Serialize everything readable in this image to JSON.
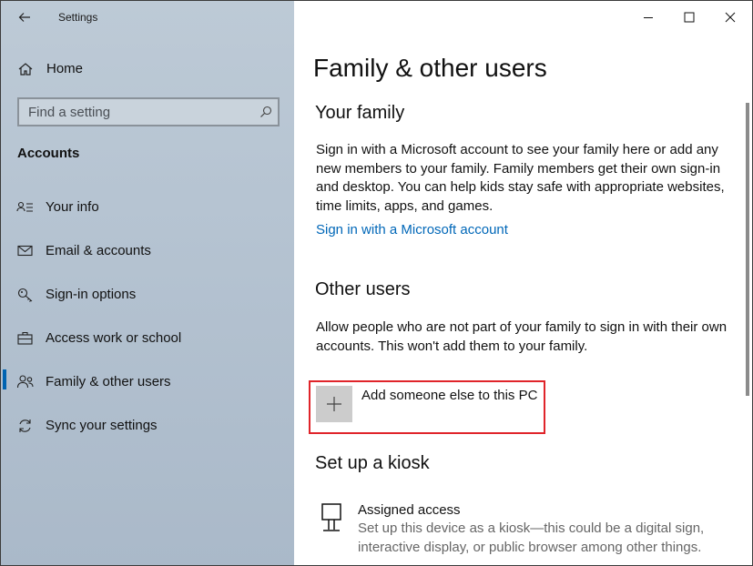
{
  "window": {
    "title": "Settings"
  },
  "sidebar": {
    "home_label": "Home",
    "search_placeholder": "Find a setting",
    "section_heading": "Accounts",
    "items": [
      {
        "label": "Your info",
        "icon": "person-card-icon"
      },
      {
        "label": "Email & accounts",
        "icon": "mail-icon"
      },
      {
        "label": "Sign-in options",
        "icon": "key-icon"
      },
      {
        "label": "Access work or school",
        "icon": "briefcase-icon"
      },
      {
        "label": "Family & other users",
        "icon": "people-icon",
        "selected": true
      },
      {
        "label": "Sync your settings",
        "icon": "sync-icon"
      }
    ],
    "accent_color": "#0063b1"
  },
  "main": {
    "title": "Family & other users",
    "family": {
      "heading": "Your family",
      "description": "Sign in with a Microsoft account to see your family here or add any new members to your family. Family members get their own sign-in and desktop. You can help kids stay safe with appropriate websites, time limits, apps, and games.",
      "link": "Sign in with a Microsoft account"
    },
    "other_users": {
      "heading": "Other users",
      "description": "Allow people who are not part of your family to sign in with their own accounts. This won't add them to your family.",
      "add_label": "Add someone else to this PC",
      "highlight_color": "#e0242a"
    },
    "kiosk": {
      "heading": "Set up a kiosk",
      "item_title": "Assigned access",
      "item_description": "Set up this device as a kiosk—this could be a digital sign, interactive display, or public browser among other things."
    },
    "link_color": "#0067b8"
  }
}
